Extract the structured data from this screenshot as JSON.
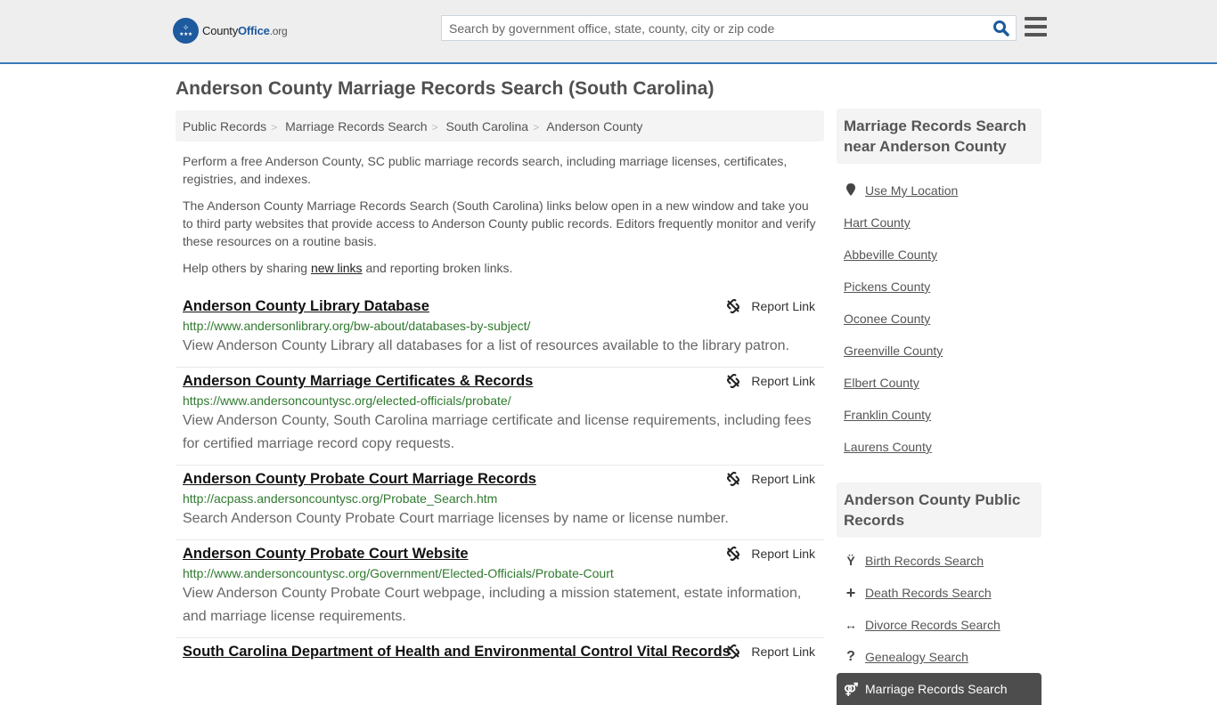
{
  "header": {
    "logo": {
      "part1": "County",
      "part2": "Office",
      "part3": ".org"
    },
    "search": {
      "placeholder": "Search by government office, state, county, city or zip code",
      "value": ""
    },
    "icons": {
      "search": "search-icon",
      "menu": "hamburger-menu-icon"
    }
  },
  "page": {
    "title": "Anderson County Marriage Records Search (South Carolina)"
  },
  "breadcrumb": [
    {
      "label": "Public Records"
    },
    {
      "label": "Marriage Records Search"
    },
    {
      "label": "South Carolina"
    },
    {
      "label": "Anderson County"
    }
  ],
  "intro": {
    "p1": "Perform a free Anderson County, SC public marriage records search, including marriage licenses, certificates, registries, and indexes.",
    "p2": "The Anderson County Marriage Records Search (South Carolina) links below open in a new window and take you to third party websites that provide access to Anderson County public records. Editors frequently monitor and verify these resources on a routine basis.",
    "p3_before": "Help others by sharing ",
    "p3_link": "new links",
    "p3_after": " and reporting broken links."
  },
  "report_label": "Report Link",
  "results": [
    {
      "title": "Anderson County Library Database",
      "url": "http://www.andersonlibrary.org/bw-about/databases-by-subject/",
      "desc": "View Anderson County Library all databases for a list of resources available to the library patron."
    },
    {
      "title": "Anderson County Marriage Certificates & Records",
      "url": "https://www.andersoncountysc.org/elected-officials/probate/",
      "desc": "View Anderson County, South Carolina marriage certificate and license requirements, including fees for certified marriage record copy requests."
    },
    {
      "title": "Anderson County Probate Court Marriage Records",
      "url": "http://acpass.andersoncountysc.org/Probate_Search.htm",
      "desc": "Search Anderson County Probate Court marriage licenses by name or license number."
    },
    {
      "title": "Anderson County Probate Court Website",
      "url": "http://www.andersoncountysc.org/Government/Elected-Officials/Probate-Court",
      "desc": "View Anderson County Probate Court webpage, including a mission statement, estate information, and marriage license requirements."
    },
    {
      "title": "South Carolina Department of Health and Environmental Control Vital Records",
      "url": "",
      "desc": ""
    }
  ],
  "sidebar": {
    "nearby": {
      "heading": "Marriage Records Search near Anderson County",
      "use_location": "Use My Location",
      "items": [
        "Hart County",
        "Abbeville County",
        "Pickens County",
        "Oconee County",
        "Greenville County",
        "Elbert County",
        "Franklin County",
        "Laurens County"
      ]
    },
    "public_records": {
      "heading": "Anderson County Public Records",
      "items": [
        {
          "label": "Birth Records Search",
          "icon": "child-icon",
          "glyph": "Ÿ"
        },
        {
          "label": "Death Records Search",
          "icon": "plus-icon",
          "glyph": "+"
        },
        {
          "label": "Divorce Records Search",
          "icon": "arrows-horizontal-icon",
          "glyph": "↔"
        },
        {
          "label": "Genealogy Search",
          "icon": "question-icon",
          "glyph": "?"
        },
        {
          "label": "Marriage Records Search",
          "icon": "marriage-symbol-icon",
          "glyph": "⚤",
          "active": true
        }
      ]
    }
  }
}
